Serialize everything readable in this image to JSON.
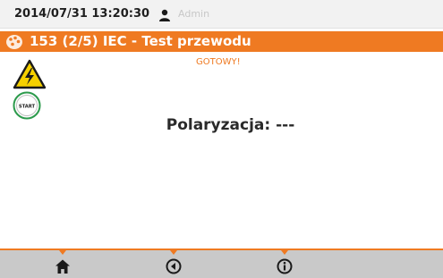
{
  "status": {
    "datetime": "2014/07/31 13:20:30",
    "user": "Admin"
  },
  "title": {
    "text": "153 (2/5) IEC - Test przewodu"
  },
  "main": {
    "status_text": "GOTOWY!",
    "start_label": "START",
    "measurement_text": "Polaryzacja: ---"
  },
  "colors": {
    "accent": "#ef7a22",
    "warning": "#f5d000",
    "start_ring": "#2c9a4c"
  },
  "toolbar": {
    "icons": [
      "home-icon",
      "back-icon",
      "info-icon"
    ]
  }
}
